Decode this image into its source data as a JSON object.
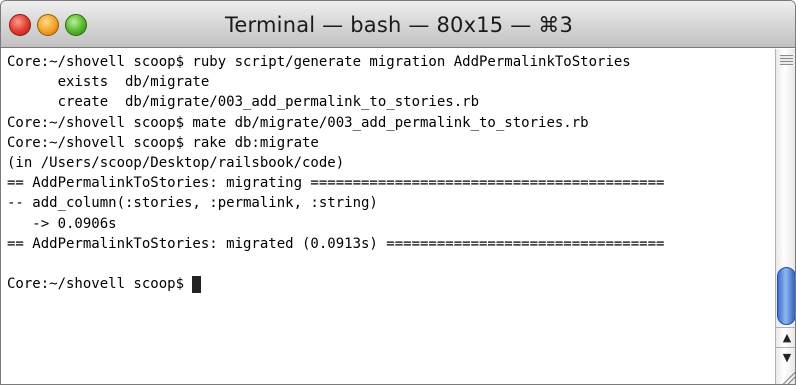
{
  "window": {
    "title": "Terminal — bash — 80x15 — ⌘3"
  },
  "terminal": {
    "lines": [
      "Core:~/shovell scoop$ ruby script/generate migration AddPermalinkToStories",
      "      exists  db/migrate",
      "      create  db/migrate/003_add_permalink_to_stories.rb",
      "Core:~/shovell scoop$ mate db/migrate/003_add_permalink_to_stories.rb",
      "Core:~/shovell scoop$ rake db:migrate",
      "(in /Users/scoop/Desktop/railsbook/code)",
      "== AddPermalinkToStories: migrating ==========================================",
      "-- add_column(:stories, :permalink, :string)",
      "   -> 0.0906s",
      "== AddPermalinkToStories: migrated (0.0913s) =================================",
      ""
    ],
    "prompt": "Core:~/shovell scoop$ "
  },
  "scrollbar": {
    "up_arrow": "▲",
    "down_arrow": "▼"
  },
  "icons": {
    "close": "close-button-icon",
    "minimize": "minimize-button-icon",
    "zoom": "zoom-button-icon"
  }
}
